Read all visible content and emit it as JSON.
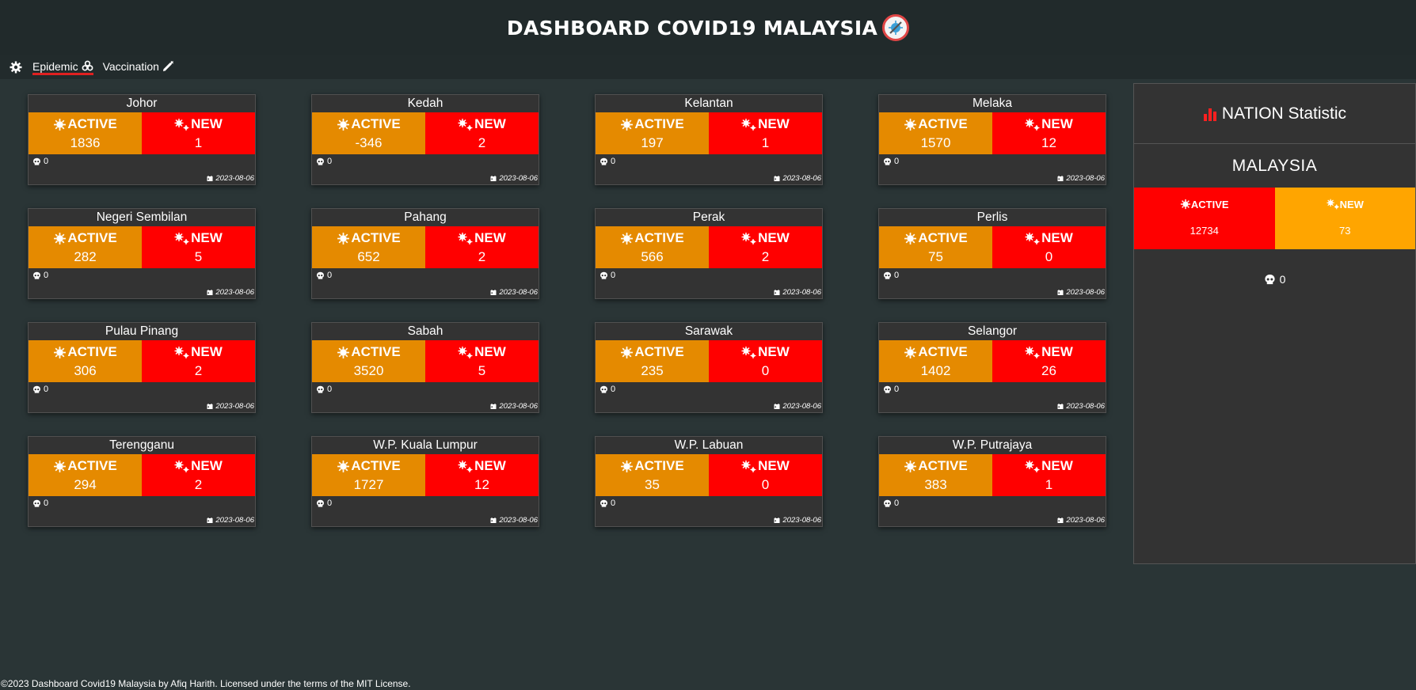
{
  "header": {
    "title": "DASHBOARD COVID19 MALAYSIA",
    "logo_icon": "virus-syringe-logo"
  },
  "nav": {
    "settings_icon": "gear-icon",
    "items": [
      {
        "label": "Epidemic",
        "icon": "biohazard-icon",
        "active": true
      },
      {
        "label": "Vaccination",
        "icon": "syringe-icon",
        "active": false
      }
    ]
  },
  "labels": {
    "active": "ACTIVE",
    "new": "NEW"
  },
  "colors": {
    "active": "#e58a00",
    "new": "#ff0000",
    "nation_active": "#ff0000",
    "nation_new": "#ffa500",
    "nav_underline": "#e02020"
  },
  "states": [
    {
      "name": "Johor",
      "active": "1836",
      "new": "1",
      "deaths": "0",
      "date": "2023-08-06"
    },
    {
      "name": "Kedah",
      "active": "-346",
      "new": "2",
      "deaths": "0",
      "date": "2023-08-06"
    },
    {
      "name": "Kelantan",
      "active": "197",
      "new": "1",
      "deaths": "0",
      "date": "2023-08-06"
    },
    {
      "name": "Melaka",
      "active": "1570",
      "new": "12",
      "deaths": "0",
      "date": "2023-08-06"
    },
    {
      "name": "Negeri Sembilan",
      "active": "282",
      "new": "5",
      "deaths": "0",
      "date": "2023-08-06"
    },
    {
      "name": "Pahang",
      "active": "652",
      "new": "2",
      "deaths": "0",
      "date": "2023-08-06"
    },
    {
      "name": "Perak",
      "active": "566",
      "new": "2",
      "deaths": "0",
      "date": "2023-08-06"
    },
    {
      "name": "Perlis",
      "active": "75",
      "new": "0",
      "deaths": "0",
      "date": "2023-08-06"
    },
    {
      "name": "Pulau Pinang",
      "active": "306",
      "new": "2",
      "deaths": "0",
      "date": "2023-08-06"
    },
    {
      "name": "Sabah",
      "active": "3520",
      "new": "5",
      "deaths": "0",
      "date": "2023-08-06"
    },
    {
      "name": "Sarawak",
      "active": "235",
      "new": "0",
      "deaths": "0",
      "date": "2023-08-06"
    },
    {
      "name": "Selangor",
      "active": "1402",
      "new": "26",
      "deaths": "0",
      "date": "2023-08-06"
    },
    {
      "name": "Terengganu",
      "active": "294",
      "new": "2",
      "deaths": "0",
      "date": "2023-08-06"
    },
    {
      "name": "W.P. Kuala Lumpur",
      "active": "1727",
      "new": "12",
      "deaths": "0",
      "date": "2023-08-06"
    },
    {
      "name": "W.P. Labuan",
      "active": "35",
      "new": "0",
      "deaths": "0",
      "date": "2023-08-06"
    },
    {
      "name": "W.P. Putrajaya",
      "active": "383",
      "new": "1",
      "deaths": "0",
      "date": "2023-08-06"
    }
  ],
  "nation": {
    "title": "NATION Statistic",
    "title_icon": "bar-chart-icon",
    "country": "MALAYSIA",
    "active": "12734",
    "new": "73",
    "deaths": "0"
  },
  "footer": {
    "text": "©2023 Dashboard Covid19 Malaysia by Afiq Harith. Licensed under the terms of the MIT License."
  }
}
